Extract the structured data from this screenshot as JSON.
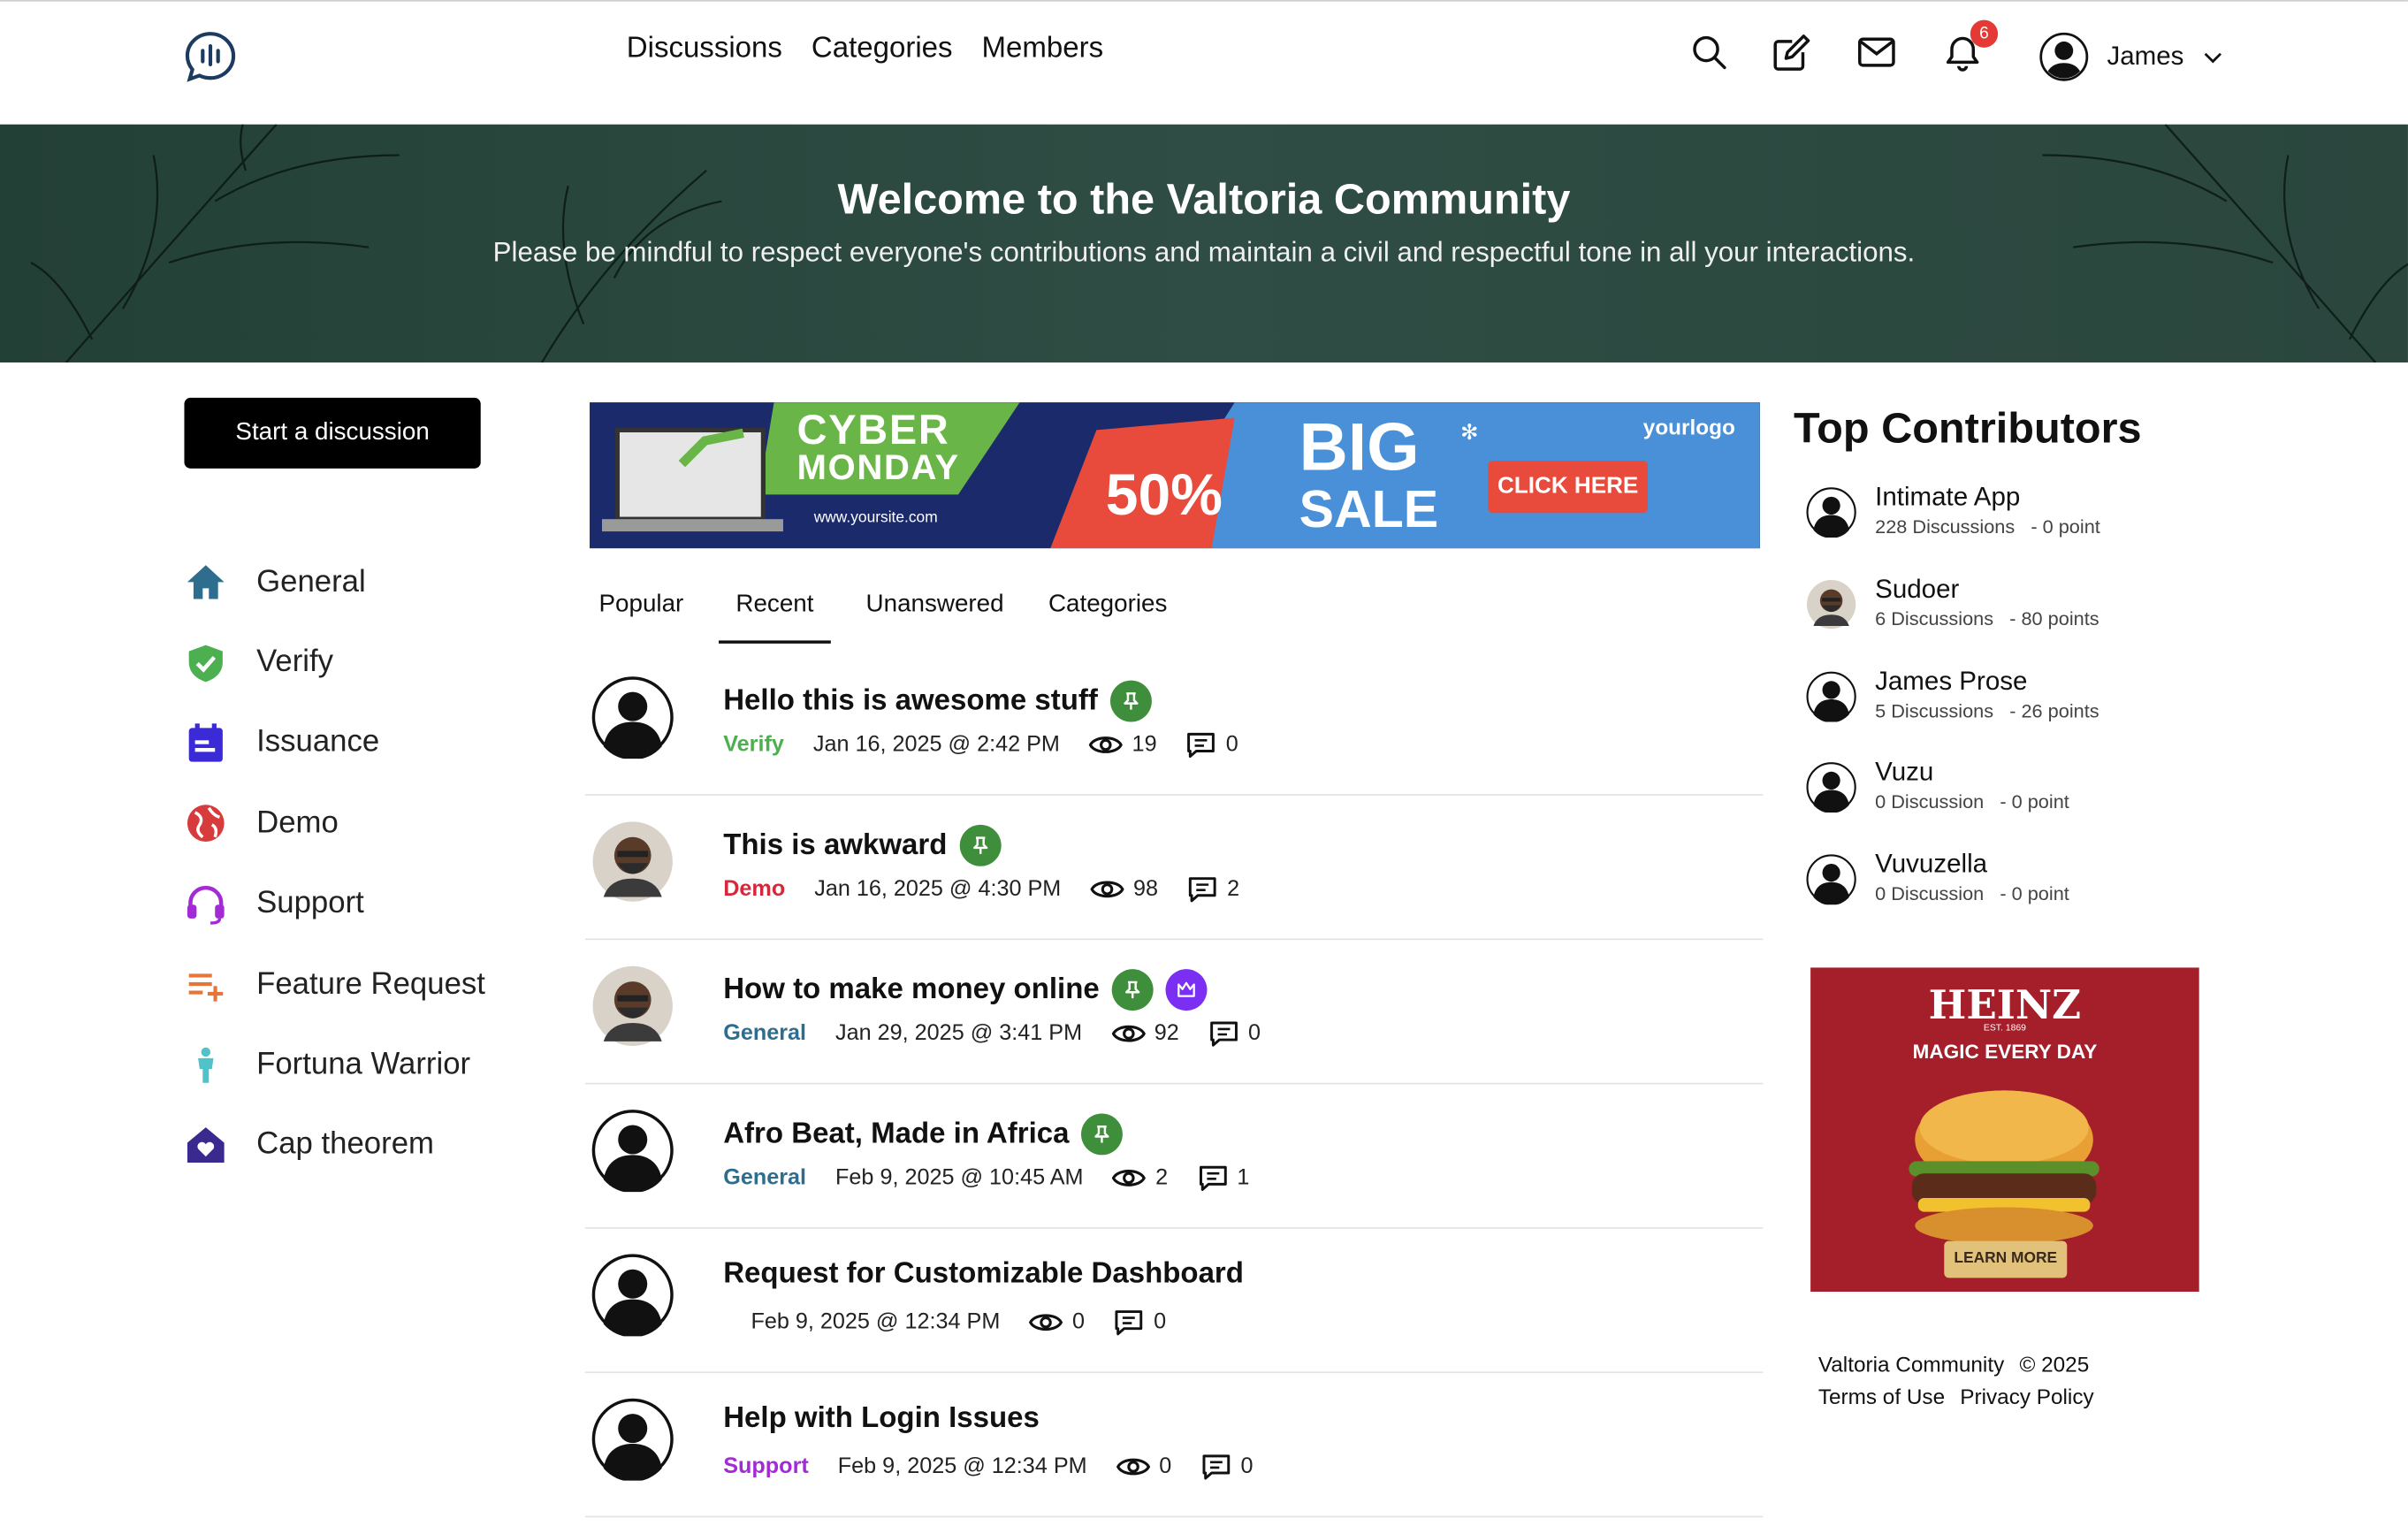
{
  "header": {
    "nav": [
      "Discussions",
      "Categories",
      "Members"
    ],
    "notification_count": "6",
    "user_name": "James"
  },
  "hero": {
    "title": "Welcome to the Valtoria Community",
    "subtitle": "Please be mindful to respect everyone's contributions and maintain a civil and respectful tone in all your interactions."
  },
  "sidebar": {
    "start_button": "Start a discussion",
    "items": [
      {
        "label": "General",
        "icon": "home-icon",
        "color": "#2f6d8f"
      },
      {
        "label": "Verify",
        "icon": "shield-check-icon",
        "color": "#4caf50"
      },
      {
        "label": "Issuance",
        "icon": "calendar-icon",
        "color": "#3b2bd6"
      },
      {
        "label": "Demo",
        "icon": "globe-icon",
        "color": "#d83b3b"
      },
      {
        "label": "Support",
        "icon": "headset-icon",
        "color": "#a32bd6"
      },
      {
        "label": "Feature Request",
        "icon": "list-add-icon",
        "color": "#e6753a"
      },
      {
        "label": "Fortuna Warrior",
        "icon": "person-icon",
        "color": "#4fc3c8"
      },
      {
        "label": "Cap theorem",
        "icon": "house-heart-icon",
        "color": "#3a2a8f"
      }
    ]
  },
  "banner": {
    "line1": "CYBER",
    "line2": "MONDAY",
    "url": "www.yoursite.com",
    "discount": "50%",
    "big": "BIG",
    "sale": "SALE",
    "cta": "CLICK HERE",
    "logo": "yourlogo"
  },
  "tabs": [
    "Popular",
    "Recent",
    "Unanswered",
    "Categories"
  ],
  "discussions": [
    {
      "title": "Hello this is awesome stuff",
      "category": "Verify",
      "category_color": "#4caf50",
      "date": "Jan 16, 2025 @ 2:42 PM",
      "views": "19",
      "comments": "0",
      "avatar": "default"
    },
    {
      "title": "This is awkward",
      "category": "Demo",
      "category_color": "#d6283b",
      "date": "Jan 16, 2025 @ 4:30 PM",
      "views": "98",
      "comments": "2",
      "avatar": "photo"
    },
    {
      "title": "How to make money online",
      "category": "General",
      "category_color": "#2f6d8f",
      "date": "Jan 29, 2025 @ 3:41 PM",
      "views": "92",
      "comments": "0",
      "avatar": "photo"
    },
    {
      "title": "Afro Beat, Made in Africa",
      "category": "General",
      "category_color": "#2f6d8f",
      "date": "Feb 9, 2025 @ 10:45 AM",
      "views": "2",
      "comments": "1",
      "avatar": "default"
    },
    {
      "title": "Request for Customizable Dashboard",
      "category": "",
      "category_color": "#222222",
      "date": "Feb 9, 2025 @ 12:34 PM",
      "views": "0",
      "comments": "0",
      "avatar": "default"
    },
    {
      "title": "Help with Login Issues",
      "category": "Support",
      "category_color": "#a32bd6",
      "date": "Feb 9, 2025 @ 12:34 PM",
      "views": "0",
      "comments": "0",
      "avatar": "default"
    }
  ],
  "top_contributors": {
    "title": "Top Contributors",
    "items": [
      {
        "name": "Intimate App",
        "discussions": "228 Discussions",
        "points": "- 0 point"
      },
      {
        "name": "Sudoer",
        "discussions": "6 Discussions",
        "points": "- 80 points"
      },
      {
        "name": "James Prose",
        "discussions": "5 Discussions",
        "points": "- 26 points"
      },
      {
        "name": "Vuzu",
        "discussions": "0 Discussion",
        "points": "- 0 point"
      },
      {
        "name": "Vuvuzella",
        "discussions": "0 Discussion",
        "points": "- 0 point"
      }
    ]
  },
  "heinz": {
    "brand": "HEINZ",
    "est": "EST. 1869",
    "tagline": "MAGIC EVERY DAY",
    "cta": "LEARN MORE"
  },
  "footer": {
    "brand": "Valtoria Community",
    "copyright": "© 2025",
    "terms": "Terms of Use",
    "privacy": "Privacy Policy"
  }
}
